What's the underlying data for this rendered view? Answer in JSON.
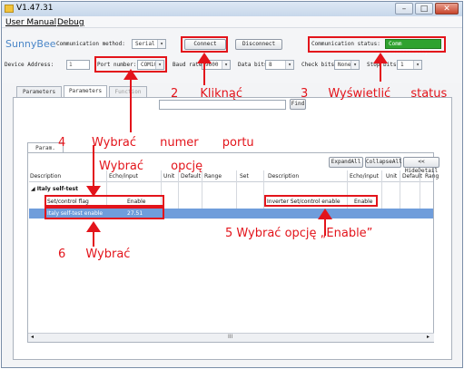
{
  "window": {
    "title": "V1.47.31",
    "controls": {
      "minimize": "–",
      "maximize": "□",
      "close": "✕"
    }
  },
  "menu": {
    "items": [
      "User Manual",
      "Debug"
    ]
  },
  "toolbar": {
    "app_name": "SunnyBee",
    "comm_method_label": "Communication method:",
    "comm_method_value": "Serial",
    "connect_label": "Connect",
    "disconnect_label": "Disconnect",
    "comm_status_label": "Communication status:",
    "comm_status_value": "Comm Successfully!",
    "device_address_label": "Device Address:",
    "device_address_value": "1",
    "port_number_label": "Port number:",
    "port_number_value": "COM10",
    "baud_rate_label": "Baud rate:",
    "baud_rate_value": "9600",
    "data_bits_label": "Data bits:",
    "data_bits_value": "8",
    "check_bits_label": "Check bits:",
    "check_bits_value": "None",
    "stop_bits_label": "Stop bits:",
    "stop_bits_value": "1"
  },
  "tabs": [
    "Parameters Slave",
    "Parameters Set",
    "Function Set"
  ],
  "find_button": "Find",
  "subtab": "Param. setting",
  "grid_buttons": {
    "expand": "ExpandAll",
    "collapse": "CollapseAll",
    "hide": "<< HideDetail"
  },
  "left_table": {
    "headers": [
      "Description",
      "Echo/input",
      "Unit",
      "Default",
      "Range",
      "Set"
    ],
    "group": "Italy self-test",
    "rows": [
      {
        "description": "Set/control flag",
        "value": "Enable"
      },
      {
        "description": "Italy self-test enable",
        "value": "27.51"
      }
    ]
  },
  "right_table": {
    "headers": [
      "Description",
      "Echo/input",
      "Unit",
      "Default",
      "Rang"
    ],
    "rows": [
      {
        "description": "Inverter Set/control enable",
        "value": "Enable"
      }
    ]
  },
  "scrollbar": {
    "left": "◂",
    "right": "▸",
    "mid": "III"
  },
  "annotations": {
    "step1": "Wybrać numer portu",
    "step2": "2 Kliknąć",
    "step3": "3 Wyświetlić status",
    "step4_num": "4",
    "step4": "Wybrać opcję",
    "step5": "5 Wybrać opcję „Enable”",
    "step6": "6 Wybrać"
  },
  "colors": {
    "annotation_red": "#e3141b",
    "selection_blue": "#6f9ddb",
    "status_green": "#2fa22f"
  }
}
